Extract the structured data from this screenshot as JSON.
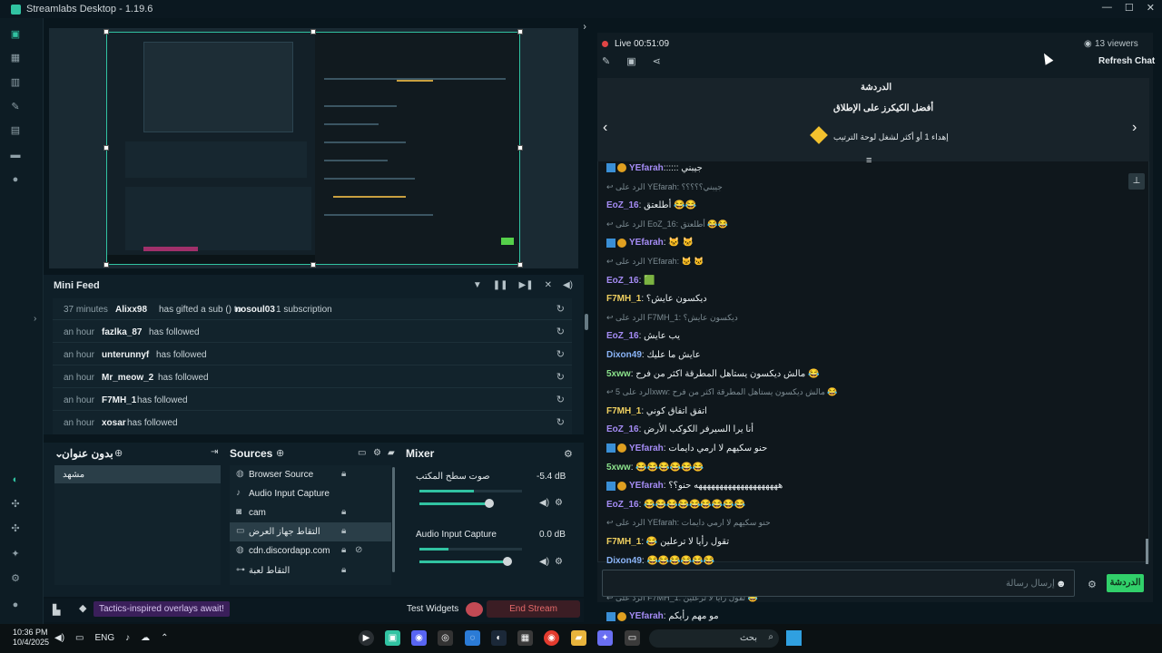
{
  "window": {
    "title": "Streamlabs Desktop - 1.19.6",
    "controls": [
      "—",
      "☐",
      "✕"
    ]
  },
  "nav": {
    "icons": [
      "editor-icon",
      "dashboard-icon",
      "layout-icon",
      "themes-icon",
      "store-icon",
      "studio-icon",
      "record-icon",
      "community-icon",
      "highlighter-icon",
      "learn-icon",
      "ai-icon",
      "settings-icon",
      "profile-icon"
    ]
  },
  "minifeed": {
    "title": "Mini Feed",
    "rows": [
      {
        "time": "37 minutes",
        "name": "Alixx98",
        "text": "has gifted a sub () to",
        "name2": "nosoul03",
        "text2": "1 subscription"
      },
      {
        "time": "an hour",
        "name": "fazlka_87",
        "text": "has followed"
      },
      {
        "time": "an hour",
        "name": "unterunnyf",
        "text": "has followed"
      },
      {
        "time": "an hour",
        "name": "Mr_meow_2",
        "text": "has followed"
      },
      {
        "time": "an hour",
        "name": "F7MH_1",
        "text": "has followed"
      },
      {
        "time": "an hour",
        "name": "xosar",
        "text": "has followed"
      }
    ]
  },
  "scenes": {
    "title": "بدون عنوان",
    "items": [
      "مشهد"
    ]
  },
  "sources": {
    "title": "Sources",
    "items": [
      {
        "label": "Browser Source",
        "icon": "globe-icon"
      },
      {
        "label": "Audio Input Capture",
        "icon": "mic-icon"
      },
      {
        "label": "cam",
        "icon": "camera-icon"
      },
      {
        "label": "التقاط جهاز العرض",
        "icon": "monitor-icon"
      },
      {
        "label": "cdn.discordapp.com",
        "icon": "globe-icon"
      },
      {
        "label": "التقاط لعبة",
        "icon": "gamepad-icon"
      }
    ]
  },
  "mixer": {
    "title": "Mixer",
    "channels": [
      {
        "name": "صوت سطح المكتب",
        "db": "-5.4 dB",
        "level": 0.68
      },
      {
        "name": "Audio Input Capture",
        "db": "0.0 dB",
        "level": 0.86
      }
    ]
  },
  "status": {
    "promo": "Tactics-inspired overlays await!",
    "test_widgets": "Test Widgets",
    "end_stream": "End Stream"
  },
  "chat": {
    "live": "Live 00:51:09",
    "viewers": "13 viewers",
    "refresh": "Refresh Chat",
    "header_title": "الدردشة",
    "header_sub": "أفضل الكيكرز على الإطلاق",
    "header_line": "إهداء 1 أو أكثر لشغل لوحة الترتيب",
    "messages": [
      {
        "type": "msg",
        "user": "YEfarah",
        "color": "purple",
        "badge": true,
        "text": ":::::: جيبني"
      },
      {
        "type": "reply",
        "text": "↩ الرد على YEfarah: جيبني؟؟؟؟؟"
      },
      {
        "type": "msg",
        "user": "EoZ_16",
        "color": "purple",
        "text": ": أطلعتق 😂😂"
      },
      {
        "type": "reply",
        "text": "↩ الرد على EoZ_16: أطلعتق 😂😂"
      },
      {
        "type": "msg",
        "user": "YEfarah",
        "color": "purple",
        "badge": true,
        "text": ": 🐱 🐱"
      },
      {
        "type": "reply",
        "text": "↩ الرد على YEfarah: 🐱 🐱"
      },
      {
        "type": "msg",
        "user": "EoZ_16",
        "color": "purple",
        "text": ": 🟩"
      },
      {
        "type": "msg",
        "user": "F7MH_1",
        "color": "yellow",
        "text": ": ديكسون عايش؟"
      },
      {
        "type": "reply",
        "text": "↩ الرد على F7MH_1: ديكسون عايش؟"
      },
      {
        "type": "msg",
        "user": "EoZ_16",
        "color": "purple",
        "text": ": يب عايش"
      },
      {
        "type": "msg",
        "user": "Dixon49",
        "color": "blue",
        "text": ": عايش ما عليك"
      },
      {
        "type": "msg",
        "user": "5xww",
        "color": "green",
        "text": ": مالش ديكسون يستاهل المطرقة اكثر من فرح 😂"
      },
      {
        "type": "reply",
        "text": "↩ الرد على 5xww: مالش ديكسون يستاهل المطرقة اكثر من فرح 😂"
      },
      {
        "type": "msg",
        "user": "F7MH_1",
        "color": "yellow",
        "text": ": اتفق اتفاق كوني"
      },
      {
        "type": "msg",
        "user": "EoZ_16",
        "color": "purple",
        "text": ": أنا يرا السيرفر الكوكب الأرض"
      },
      {
        "type": "msg",
        "user": "YEfarah",
        "color": "purple",
        "badge": true,
        "text": ": حنو سكيهم لا ارمي دايمات"
      },
      {
        "type": "msg",
        "user": "5xww",
        "color": "green",
        "text": ": 😂😂😂😂😂😂"
      },
      {
        "type": "msg",
        "user": "YEfarah",
        "color": "purple",
        "badge": true,
        "text": ": ههههههههههههههههههههه حنو؟؟"
      },
      {
        "type": "msg",
        "user": "EoZ_16",
        "color": "purple",
        "text": ": 😂😂😂😂😂😂😂😂😂"
      },
      {
        "type": "reply",
        "text": "↩ الرد على YEfarah: حنو سكيهم لا ارمي دايمات"
      },
      {
        "type": "msg",
        "user": "F7MH_1",
        "color": "yellow",
        "text": ": 😂 تقول رأيا لا ترعلين"
      },
      {
        "type": "msg",
        "user": "Dixon49",
        "color": "blue",
        "text": ": 😂😂😂😂😂😂"
      },
      {
        "type": "msg",
        "user": "EoZ_16",
        "color": "purple",
        "text": ": دخاف من وش"
      },
      {
        "type": "reply",
        "text": "↩ الرد على F7MH_1: تقول رأيا لا ترعلين 😂"
      },
      {
        "type": "msg",
        "user": "YEfarah",
        "color": "purple",
        "badge": true,
        "text": ": مو مهم رأيكم"
      }
    ],
    "input_placeholder": "إرسال رسالة",
    "send_label": "الدردشة"
  },
  "taskbar": {
    "time": "10:36 PM",
    "date": "10/4/2025",
    "lang": "ENG",
    "search_placeholder": "بحث"
  }
}
